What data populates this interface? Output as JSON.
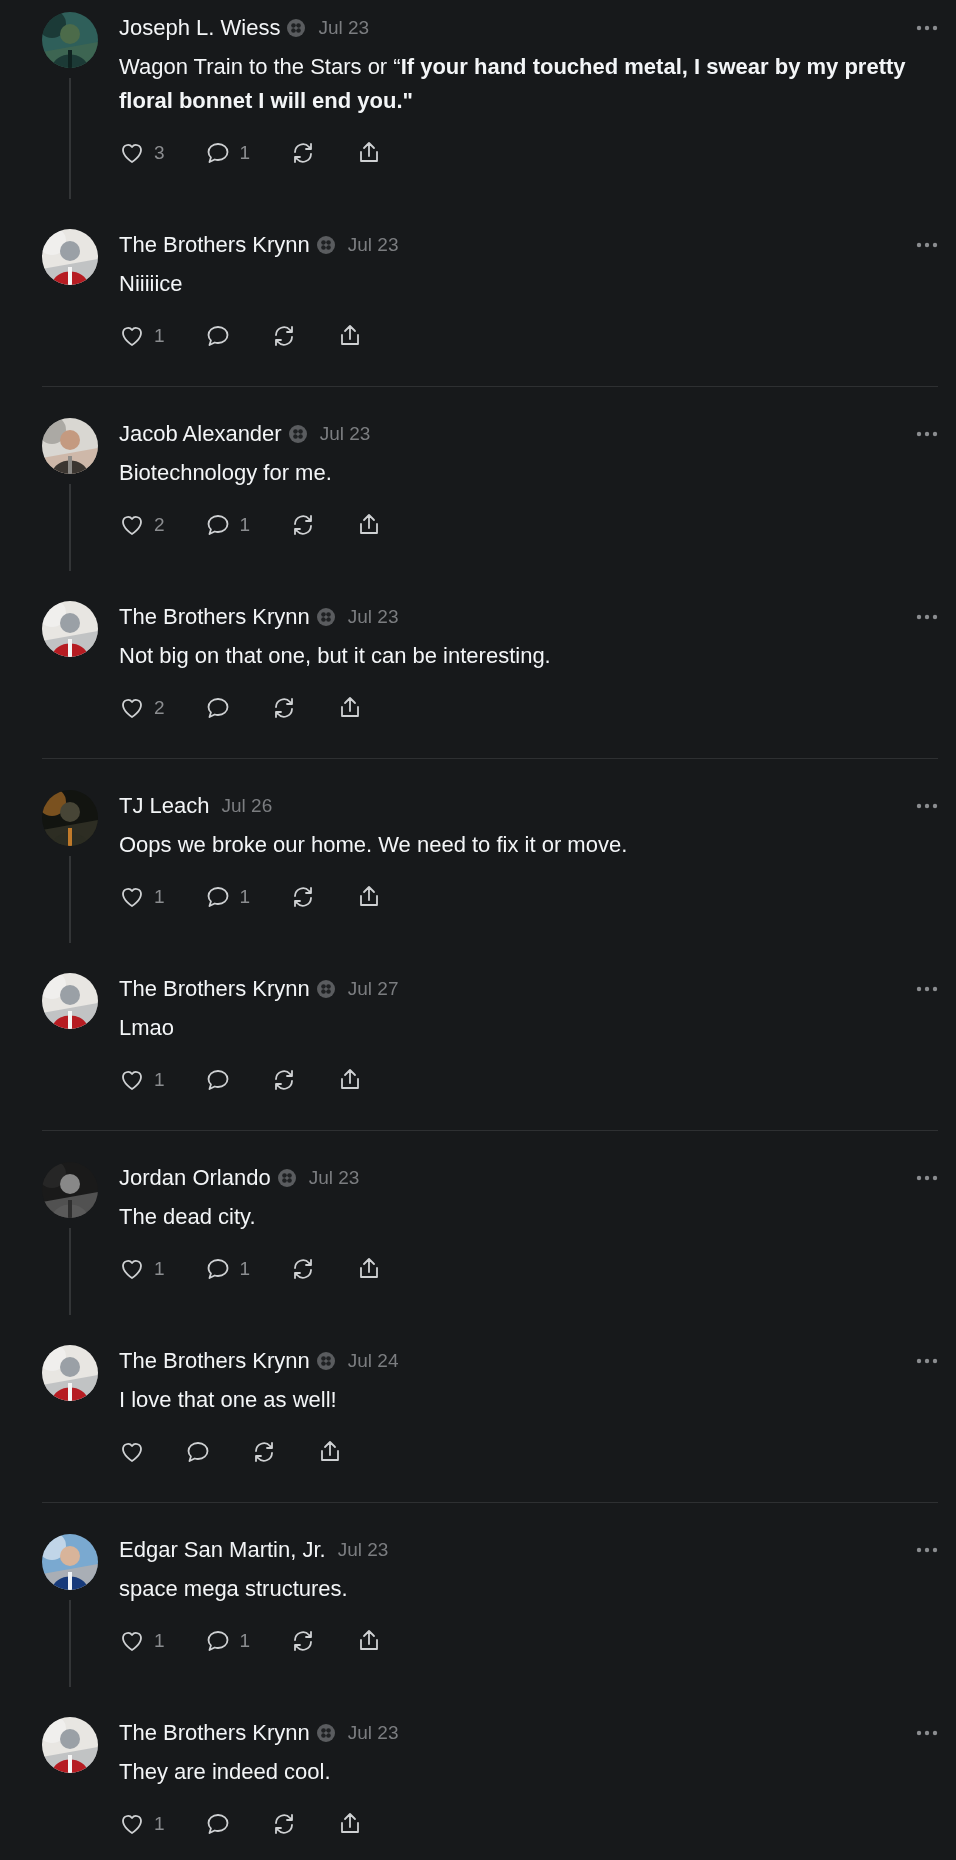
{
  "threads": [
    {
      "posts": [
        {
          "author": "Joseph L. Wiess",
          "verified": true,
          "date": "Jul 23",
          "text": "Wagon Train to the Stars or “**If your hand touched metal, I swear by my pretty floral bonnet I will end you.\"**",
          "likes": "3",
          "replies": "1"
        },
        {
          "author": "The Brothers Krynn",
          "verified": true,
          "date": "Jul 23",
          "text": "Niiiiice",
          "likes": "1"
        }
      ]
    },
    {
      "posts": [
        {
          "author": "Jacob Alexander",
          "verified": true,
          "date": "Jul 23",
          "text": "Biotechnology for me.",
          "likes": "2",
          "replies": "1"
        },
        {
          "author": "The Brothers Krynn",
          "verified": true,
          "date": "Jul 23",
          "text": "Not big on that one, but it can be interesting.",
          "likes": "2"
        }
      ]
    },
    {
      "posts": [
        {
          "author": "TJ Leach",
          "verified": false,
          "date": "Jul 26",
          "text": "Oops we broke our home. We need to fix it or move.",
          "likes": "1",
          "replies": "1"
        },
        {
          "author": "The Brothers Krynn",
          "verified": true,
          "date": "Jul 27",
          "text": "Lmao",
          "likes": "1"
        }
      ]
    },
    {
      "posts": [
        {
          "author": "Jordan Orlando",
          "verified": true,
          "date": "Jul 23",
          "text": "The dead city.",
          "likes": "1",
          "replies": "1"
        },
        {
          "author": "The Brothers Krynn",
          "verified": true,
          "date": "Jul 24",
          "text": "I love that one as well!"
        }
      ]
    },
    {
      "posts": [
        {
          "author": "Edgar San Martin, Jr.",
          "verified": false,
          "date": "Jul 23",
          "text": "space mega structures.",
          "likes": "1",
          "replies": "1"
        },
        {
          "author": "The Brothers Krynn",
          "verified": true,
          "date": "Jul 23",
          "text": "They are indeed cool.",
          "likes": "1"
        }
      ]
    }
  ]
}
